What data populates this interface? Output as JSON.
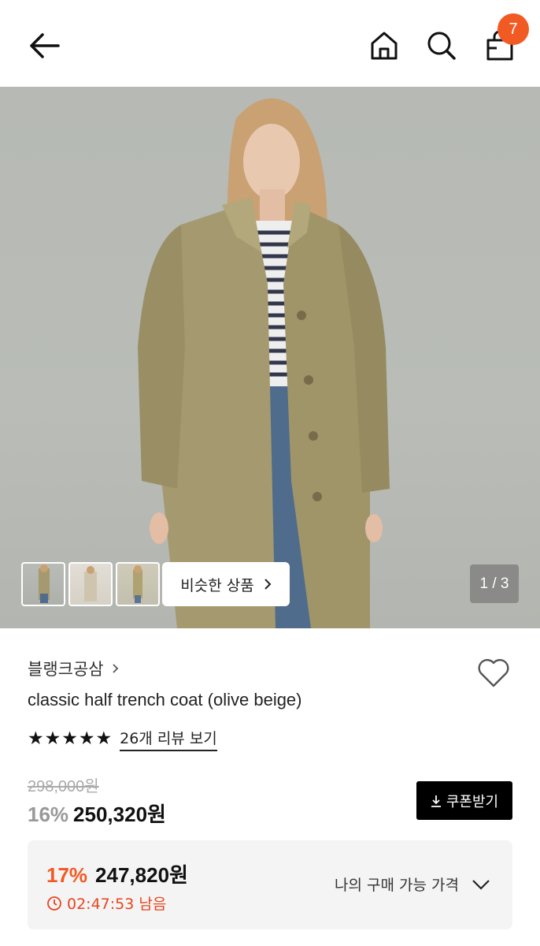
{
  "header": {
    "back_icon": "arrow-left-icon",
    "home_icon": "home-icon",
    "search_icon": "search-icon",
    "cart_icon": "shopping-bag-icon",
    "cart_count": "7",
    "badge_color": "#f25a24"
  },
  "gallery": {
    "similar_label": "비슷한 상품",
    "page_indicator": "1 / 3"
  },
  "product": {
    "brand": "블랭크공삼",
    "title": "classic half trench coat (olive beige)",
    "rating_stars": 5,
    "review_link": "26개 리뷰 보기",
    "original_price": "298,000원",
    "discount": "16%",
    "price": "250,320원",
    "coupon_label": "쿠폰받기"
  },
  "my_price": {
    "discount": "17%",
    "price": "247,820원",
    "timer": "02:47:53 남음",
    "label": "나의 구매 가능 가격",
    "accent": "#f25a24"
  }
}
